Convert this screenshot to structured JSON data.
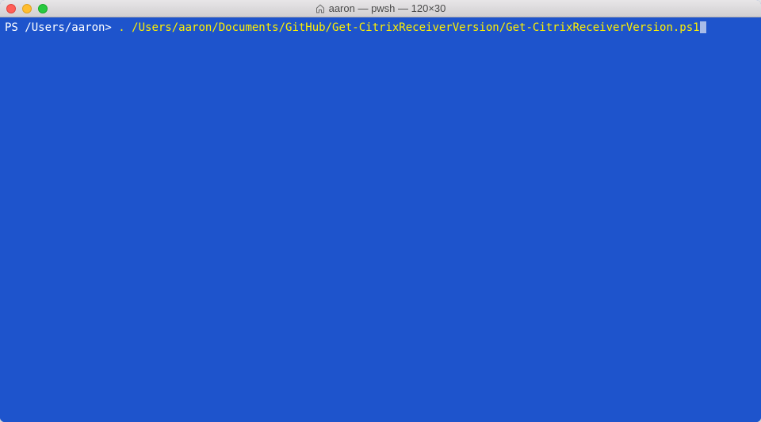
{
  "titlebar": {
    "title": "aaron — pwsh — 120×30"
  },
  "terminal": {
    "prompt": "PS /Users/aaron> ",
    "command": ". /Users/aaron/Documents/GitHub/Get-CitrixReceiverVersion/Get-CitrixReceiverVersion.ps1"
  }
}
